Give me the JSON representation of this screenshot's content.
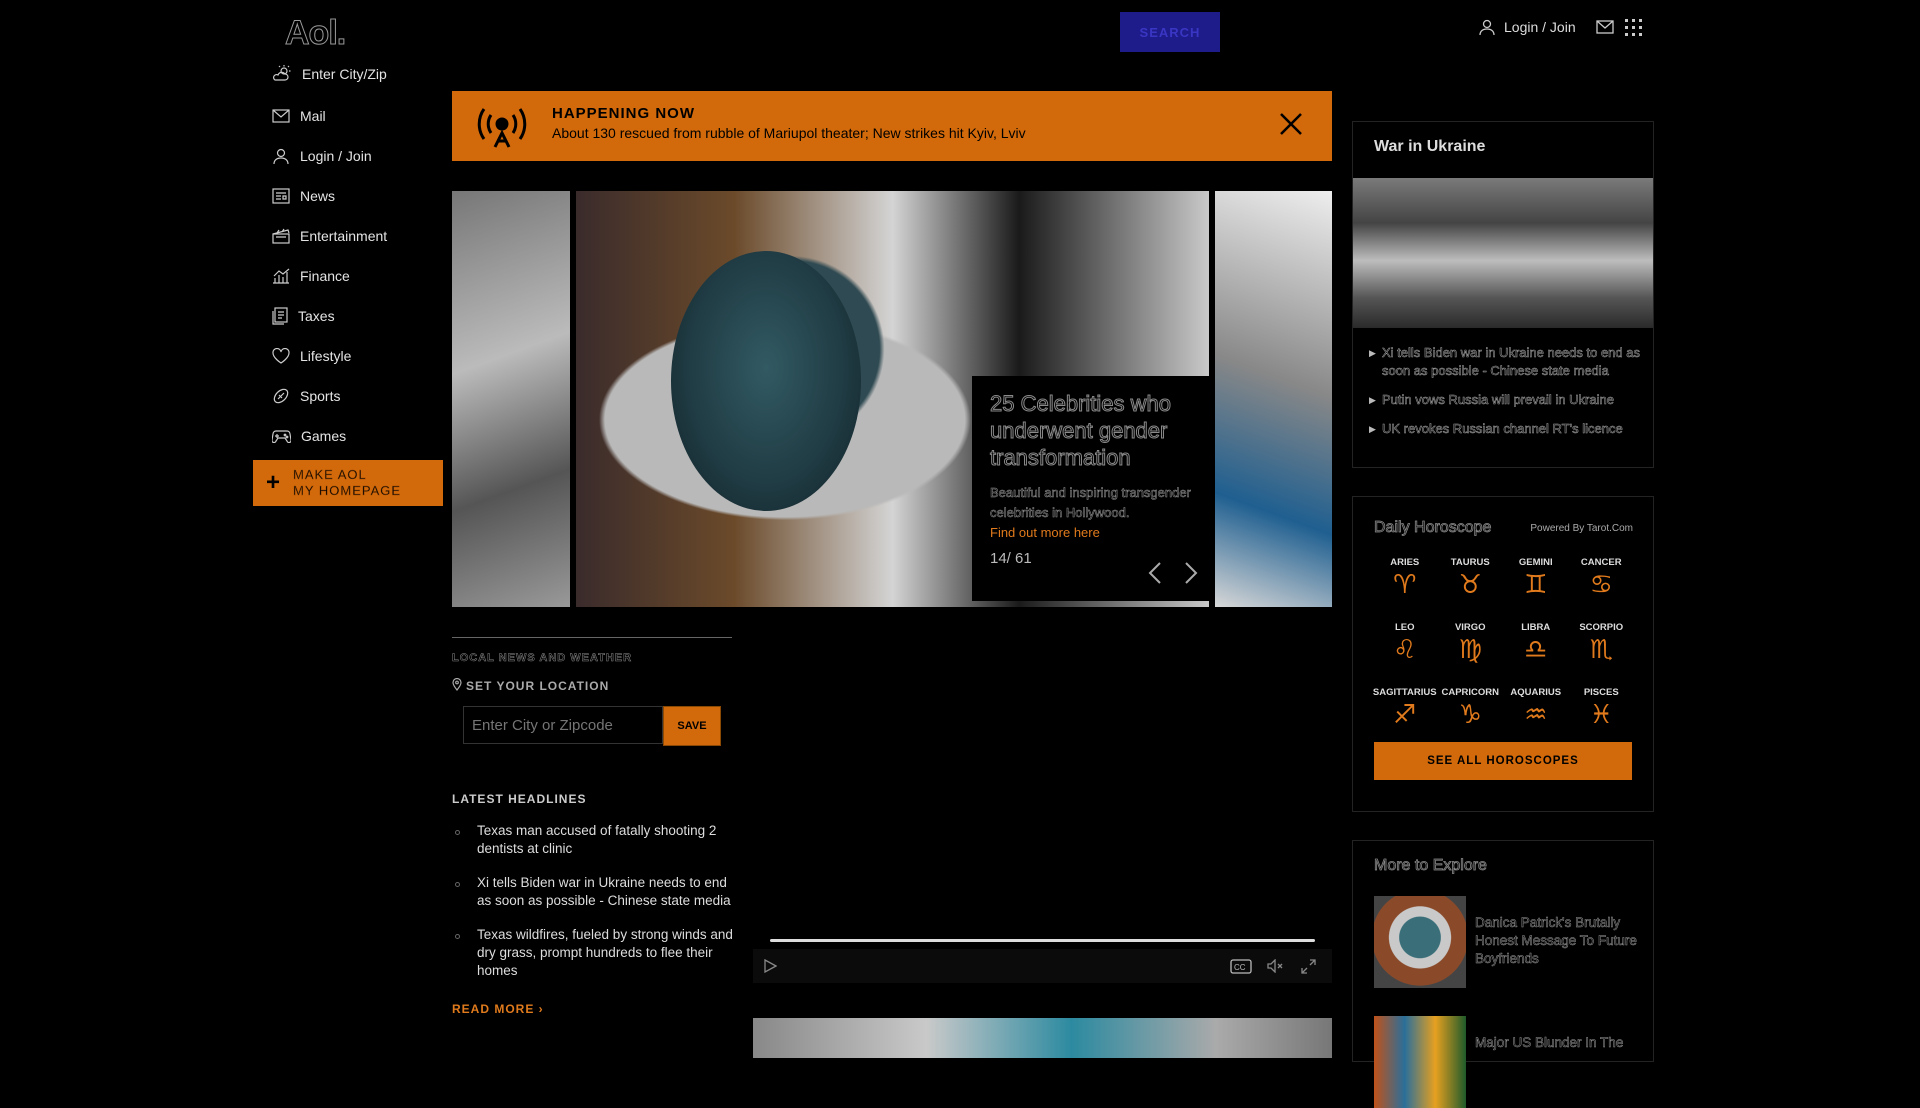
{
  "header": {
    "logo": "Aol.",
    "search_label": "SEARCH",
    "login_label": "Login / Join"
  },
  "sidebar": {
    "weather_label": "Enter City/Zip",
    "items": [
      {
        "label": "Mail",
        "icon": "mail-icon"
      },
      {
        "label": "Login / Join",
        "icon": "user-icon"
      },
      {
        "label": "News",
        "icon": "news-icon"
      },
      {
        "label": "Entertainment",
        "icon": "clapper-icon"
      },
      {
        "label": "Finance",
        "icon": "chart-icon"
      },
      {
        "label": "Taxes",
        "icon": "document-icon"
      },
      {
        "label": "Lifestyle",
        "icon": "heart-icon"
      },
      {
        "label": "Sports",
        "icon": "ball-icon"
      },
      {
        "label": "Games",
        "icon": "gamepad-icon"
      }
    ],
    "make_home_line1": "MAKE AOL",
    "make_home_line2": "MY HOMEPAGE"
  },
  "banner": {
    "title": "HAPPENING NOW",
    "text": "About 130 rescued from rubble of Mariupol theater; New strikes hit Kyiv, Lviv"
  },
  "carousel": {
    "title": "25 Celebrities who underwent gender transformation",
    "description": "Beautiful and inspiring transgender celebrities in Hollywood.",
    "link": "Find out more here",
    "counter": "14/ 61"
  },
  "local": {
    "title": "LOCAL NEWS AND WEATHER",
    "location_label": "SET YOUR LOCATION",
    "zip_placeholder": "Enter City or Zipcode",
    "save_label": "SAVE"
  },
  "latest": {
    "title": "LATEST HEADLINES",
    "items": [
      "Texas man accused of fatally shooting 2 dentists at clinic",
      "Xi tells Biden war in Ukraine needs to end as soon as possible - Chinese state media",
      "Texas wildfires, fueled by strong winds and dry grass, prompt hundreds to flee their homes"
    ],
    "read_more": "READ MORE ›"
  },
  "war": {
    "title": "War in Ukraine",
    "items": [
      "Xi tells Biden war in Ukraine needs to end as soon as possible - Chinese state media",
      "Putin vows Russia will prevail in Ukraine",
      "UK revokes Russian channel RT's licence"
    ]
  },
  "horoscope": {
    "title": "Daily Horoscope",
    "powered": "Powered By Tarot.Com",
    "signs": [
      {
        "name": "ARIES",
        "glyph": "♈"
      },
      {
        "name": "TAURUS",
        "glyph": "♉"
      },
      {
        "name": "GEMINI",
        "glyph": "♊"
      },
      {
        "name": "CANCER",
        "glyph": "♋"
      },
      {
        "name": "LEO",
        "glyph": "♌"
      },
      {
        "name": "VIRGO",
        "glyph": "♍"
      },
      {
        "name": "LIBRA",
        "glyph": "♎"
      },
      {
        "name": "SCORPIO",
        "glyph": "♏"
      },
      {
        "name": "SAGITTARIUS",
        "glyph": "♐"
      },
      {
        "name": "CAPRICORN",
        "glyph": "♑"
      },
      {
        "name": "AQUARIUS",
        "glyph": "♒"
      },
      {
        "name": "PISCES",
        "glyph": "♓"
      }
    ],
    "button": "SEE ALL HOROSCOPES"
  },
  "explore": {
    "title": "More to Explore",
    "items": [
      "Danica Patrick's Brutally Honest Message To Future Boyfriends",
      "Major US Blunder In The"
    ]
  },
  "colors": {
    "accent": "#d2690a",
    "search": "#1e1b8a",
    "link": "#e07a1c"
  }
}
